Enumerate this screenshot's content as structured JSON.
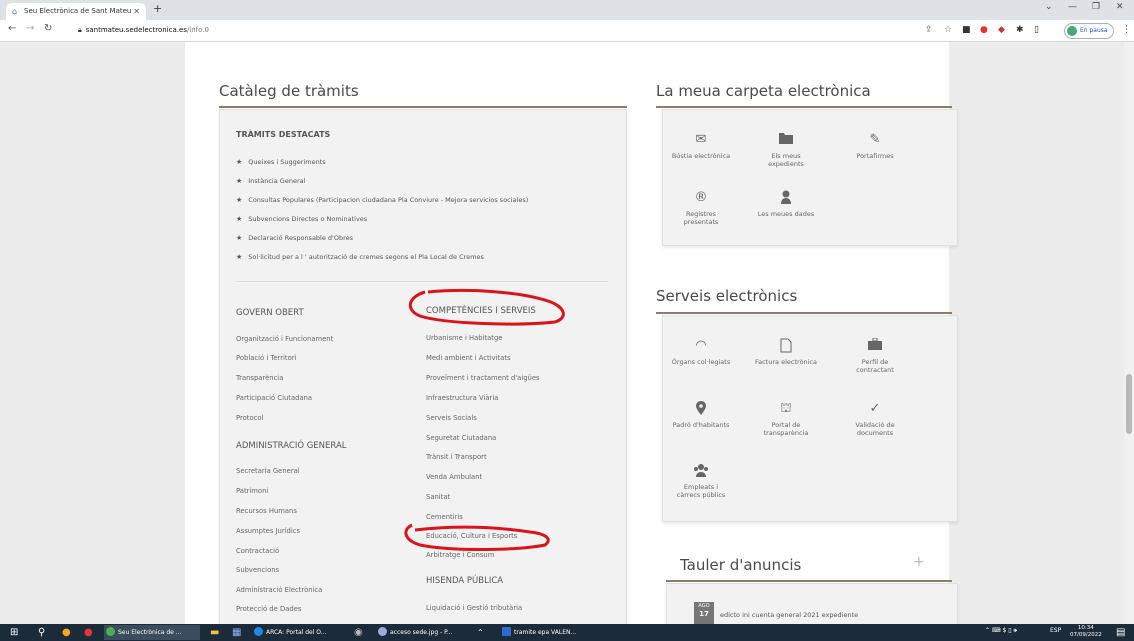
{
  "browser": {
    "tab_title": "Seu Electrònica de Sant Mateu",
    "url_domain": "santmateu.sedelectronica.es",
    "url_path": "/info.0",
    "profile_label": "En pausa"
  },
  "catalog": {
    "title": "Catàleg de tràmits",
    "featured_heading": "TRÀMITS DESTACATS",
    "featured": [
      "Queixes i Suggeriments",
      "Instància General",
      "Consultas Populares (Participacion ciudadana Pla Conviure - Mejora servicios sociales)",
      "Subvencions Directes o Nominatives",
      "Declaració Responsable d'Obres",
      "Sol·licitud per a l ' autorització de cremes segons el Pla Local de Cremes"
    ],
    "govern_heading": "GOVERN OBERT",
    "govern_items": [
      "Organització i Funcionament",
      "Població i Territori",
      "Transparència",
      "Participació Ciutadana",
      "Protocol"
    ],
    "admin_heading": "ADMINISTRACIÓ GENERAL",
    "admin_items": [
      "Secretaria General",
      "Patrimoni",
      "Recursos Humans",
      "Assumptes Jurídics",
      "Contractació",
      "Subvencions",
      "Administració Electrònica",
      "Protecció de Dades"
    ],
    "comp_heading": "COMPETÈNCIES I SERVEIS",
    "comp_items": [
      "Urbanisme i Habitatge",
      "Medi ambient i Activitats",
      "Proveïment i tractament d'aigües",
      "Infraestructura Viària",
      "Serveis Socials",
      "Seguretat Ciutadana",
      "Trànsit i Transport",
      "Venda Ambulant",
      "Sanitat",
      "Cementiris",
      "Educació, Cultura i Esports",
      "Arbitratge i Consum"
    ],
    "hisenda_heading": "HISENDA PÚBLICA",
    "hisenda_items": [
      "Liquidació i Gestió tributària"
    ]
  },
  "folder": {
    "title": "La meua carpeta electrònica",
    "items": [
      {
        "label": "Bústia electrònica",
        "icon": "envelope-icon"
      },
      {
        "label": "Els meus expedients",
        "icon": "folder-icon"
      },
      {
        "label": "Portafirmes",
        "icon": "signature-icon"
      },
      {
        "label": "Registres presentats",
        "icon": "registered-icon"
      },
      {
        "label": "Les meues dades",
        "icon": "user-icon"
      }
    ]
  },
  "services": {
    "title": "Serveis electrònics",
    "items": [
      {
        "label": "Òrgans col·legiats",
        "icon": "signal-icon"
      },
      {
        "label": "Factura electrònica",
        "icon": "document-icon"
      },
      {
        "label": "Perfil de contractant",
        "icon": "briefcase-icon"
      },
      {
        "label": "Padró d'habitants",
        "icon": "map-pin-icon"
      },
      {
        "label": "Portal de transparència",
        "icon": "building-icon"
      },
      {
        "label": "Validació de documents",
        "icon": "checkmark-icon"
      },
      {
        "label": "Empleats i càrrecs públics",
        "icon": "people-icon"
      }
    ]
  },
  "board": {
    "title": "Tauler d'anuncis",
    "month": "AGO",
    "day": "17",
    "item": "edicto ini cuenta general 2021 expediente"
  },
  "taskbar": {
    "items": [
      "Seu Electrònica de ...",
      "ARCA: Portal del O...",
      "acceso sede.jpg - P...",
      "tramite epa VALEN..."
    ],
    "lang": "ESP",
    "time": "10:34",
    "date": "07/09/2022"
  },
  "colors": {
    "accent_line": "#8a7d6d",
    "annotation_red": "#d9141b",
    "taskbar": "#1c2b3a"
  }
}
